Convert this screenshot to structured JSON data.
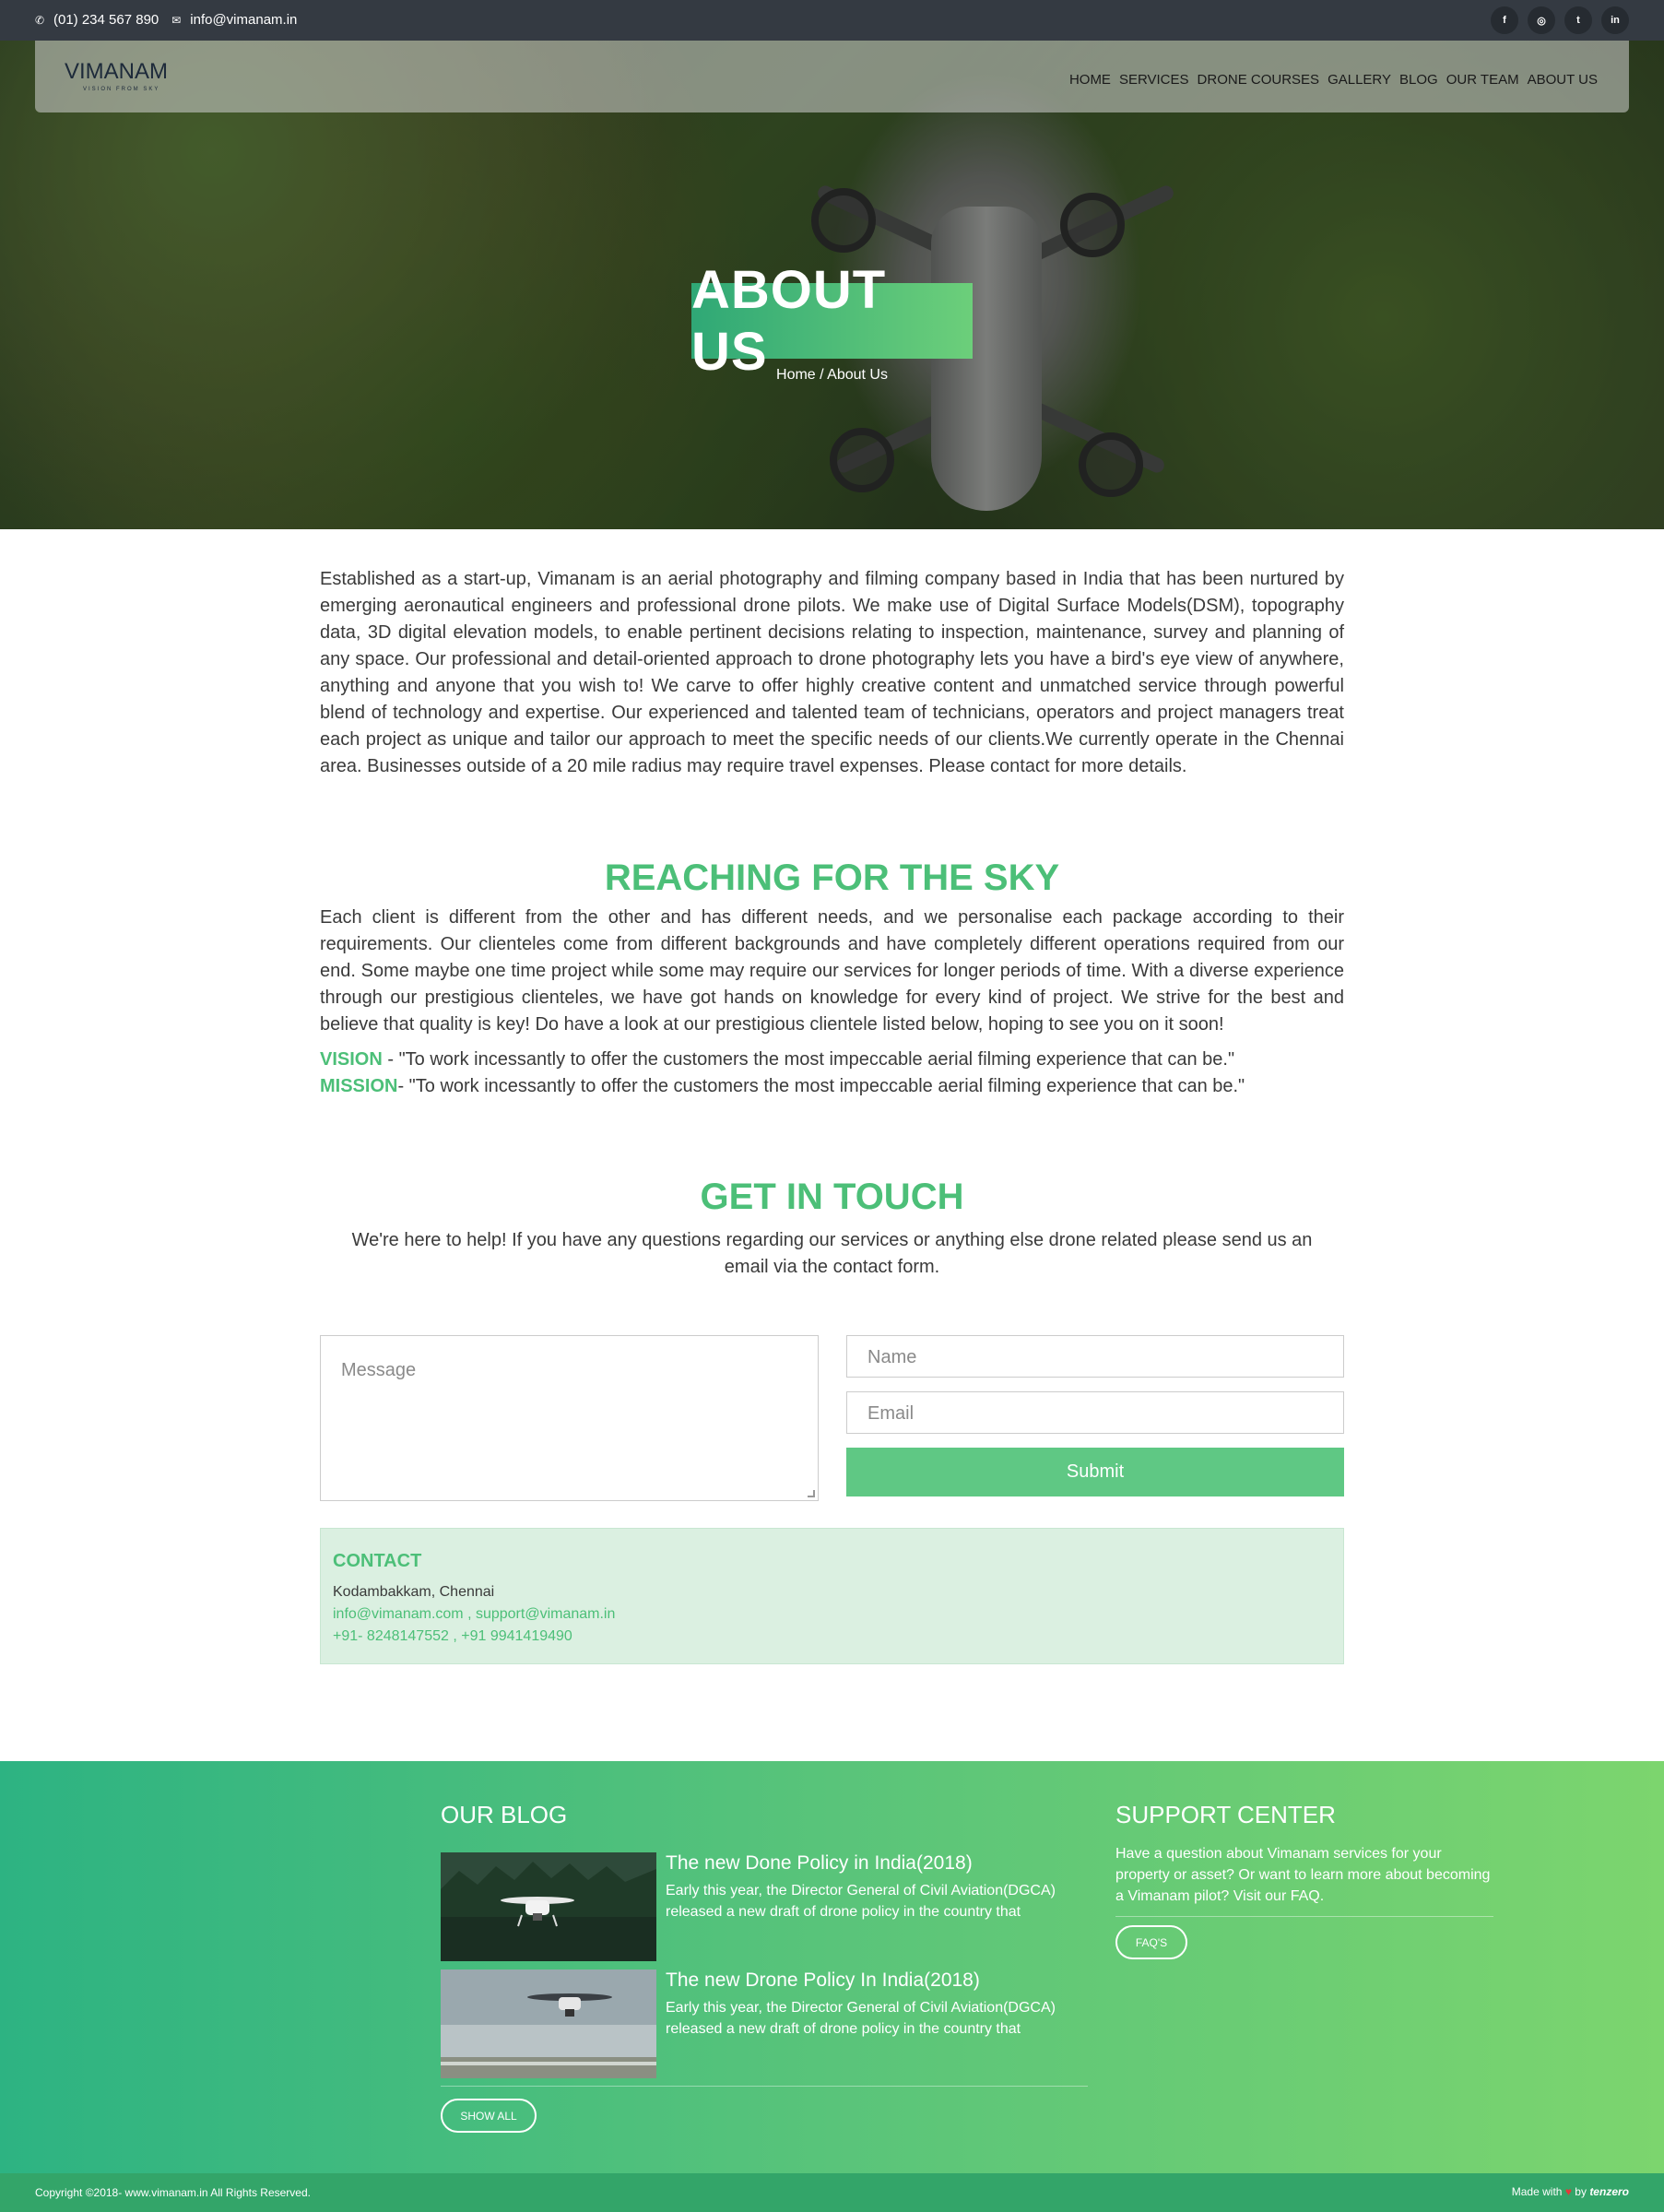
{
  "topbar": {
    "phone": "(01) 234 567 890",
    "email": "info@vimanam.in",
    "social": [
      "f",
      "◎",
      "t",
      "in"
    ]
  },
  "nav": {
    "logo_word": "VIMANAM",
    "logo_tag": "VISION FROM SKY",
    "items": [
      "HOME",
      "SERVICES",
      "DRONE COURSES",
      "GALLERY",
      "BLOG",
      "OUR TEAM",
      "ABOUT US"
    ]
  },
  "hero": {
    "title": "ABOUT US",
    "breadcrumb": "Home / About Us"
  },
  "intro": "Established as a start-up, Vimanam is an aerial photography and filming company based in India that has been nurtured by emerging aeronautical engineers and professional drone pilots. We make use of Digital Surface Models(DSM), topography data, 3D digital elevation models, to enable pertinent decisions relating to inspection, maintenance, survey and planning of any space. Our professional and detail-oriented approach to drone photography lets you have a bird's eye view of anywhere, anything and anyone that you wish to! We carve to offer highly creative content and unmatched service through powerful blend of technology and expertise. Our experienced and talented team of technicians, operators and project managers treat each project as unique and tailor our approach to meet the specific needs of our clients.We currently operate in the Chennai area. Businesses outside of a 20 mile radius may require travel expenses. Please contact for more details.",
  "reaching": {
    "heading": "REACHING FOR THE SKY",
    "text": "Each client is different from the other and has different needs, and we personalise each package according to their requirements. Our clienteles come from different backgrounds and have completely different operations required from our end. Some maybe one time project while some may require our services for longer periods of time. With a diverse experience through our prestigious clienteles, we have got hands on knowledge for every kind of project. We strive for the best and believe that quality is key! Do have a look at our prestigious clientele listed below, hoping to see you on it soon!",
    "vision_label": "VISION",
    "vision_text": " - \"To work incessantly to offer the customers the most impeccable aerial filming experience that can be.\"",
    "mission_label": "MISSION",
    "mission_text": "- \"To work incessantly to offer the customers the most impeccable aerial filming experience that can be.\""
  },
  "touch": {
    "heading": "GET IN TOUCH",
    "text": "We're here to help! If you have any questions regarding our services or anything else drone related please send us an email via the contact form.",
    "message_placeholder": "Message",
    "name_placeholder": "Name",
    "email_placeholder": "Email",
    "submit": "Submit"
  },
  "contact": {
    "heading": "CONTACT",
    "address": "Kodambakkam, Chennai",
    "emails": "info@vimanam.com , support@vimanam.in",
    "phones": "+91- 8248147552 , +91 9941419490"
  },
  "footer": {
    "blog_heading": "OUR BLOG",
    "posts": [
      {
        "title": "The new Done Policy in India(2018)",
        "text": "Early this year, the Director General of Civil Aviation(DGCA) released a new draft of drone policy in the country that"
      },
      {
        "title": "The new Drone Policy In India(2018)",
        "text": "Early this year, the Director General of Civil Aviation(DGCA) released a new draft of drone policy in the country that"
      }
    ],
    "show_all": "SHOW ALL",
    "support_heading": "SUPPORT CENTER",
    "support_text": "Have a question about Vimanam services for your property or asset? Or want to learn more about becoming a Vimanam pilot? Visit our FAQ.",
    "faq": "FAQ'S"
  },
  "bottom": {
    "copyright": "Copyright ©2018- www.vimanam.in All Rights Reserved.",
    "made_with": "Made with",
    "by": "by",
    "brand": "tenzero"
  },
  "colors": {
    "accent": "#4cbf78",
    "topbar": "#343a42",
    "footer_start": "#2db382",
    "footer_end": "#7cd56e"
  }
}
